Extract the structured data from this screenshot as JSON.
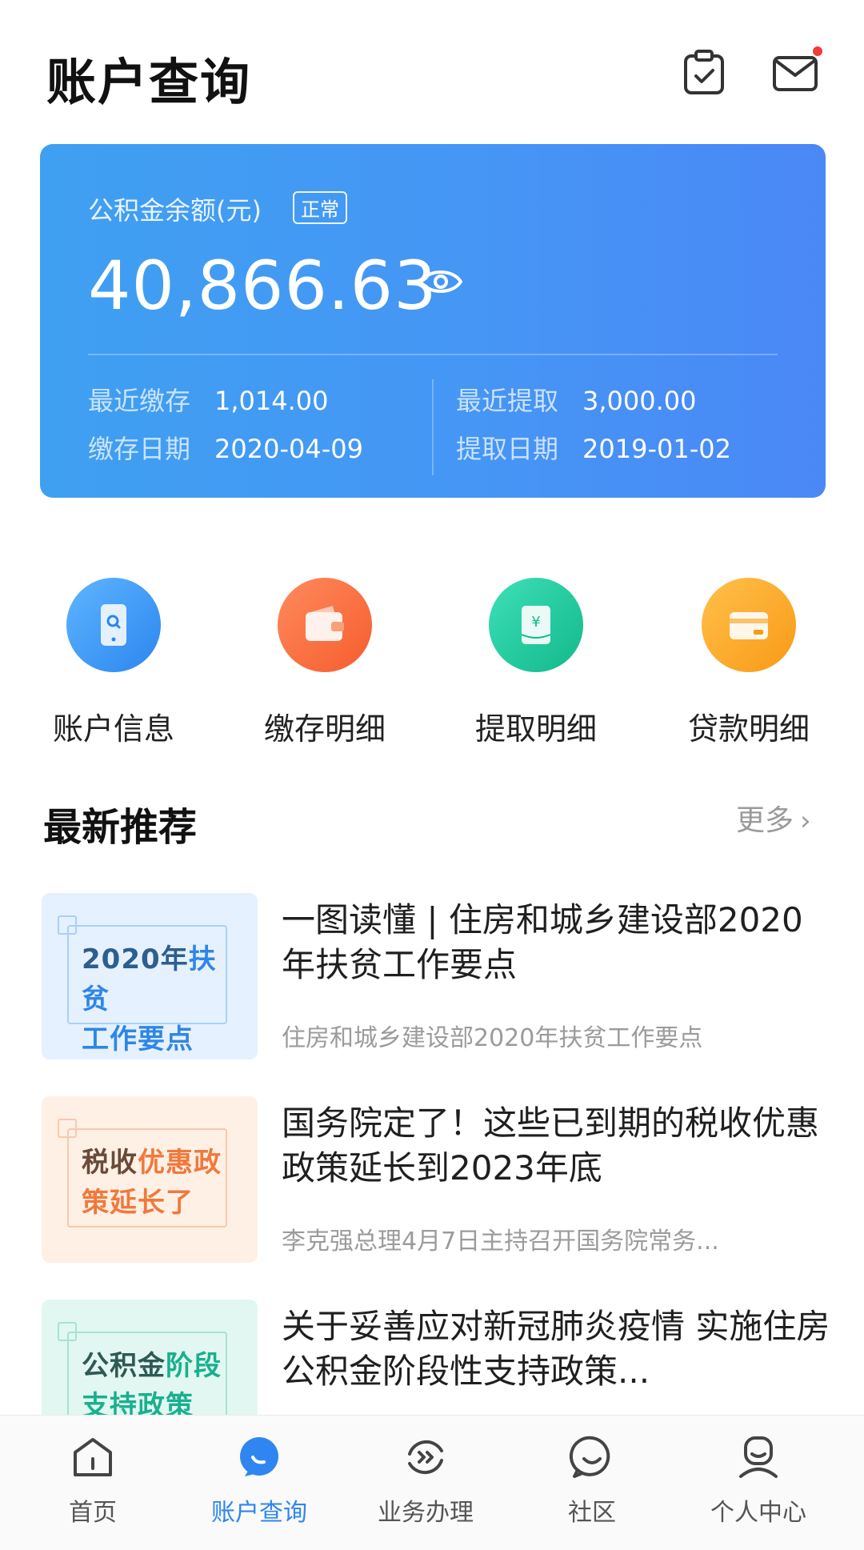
{
  "header": {
    "title": "账户查询",
    "clipboard_icon": "clipboard-check-icon",
    "mail_icon": "mail-icon",
    "mail_has_unread": true
  },
  "balance_card": {
    "label": "公积金余额(元)",
    "status": "正常",
    "amount": "40,866.63",
    "eye_icon": "eye-icon",
    "recent_deposit_label": "最近缴存",
    "recent_deposit_value": "1,014.00",
    "deposit_date_label": "缴存日期",
    "deposit_date_value": "2020-04-09",
    "recent_withdraw_label": "最近提取",
    "recent_withdraw_value": "3,000.00",
    "withdraw_date_label": "提取日期",
    "withdraw_date_value": "2019-01-02",
    "colors": {
      "start": "#3fa0f1",
      "end": "#4a88f6"
    }
  },
  "quick_actions": [
    {
      "label": "账户信息",
      "icon": "phone-search-icon",
      "color": "#2b86ef"
    },
    {
      "label": "缴存明细",
      "icon": "wallet-icon",
      "color": "#f55d2e"
    },
    {
      "label": "提取明细",
      "icon": "yuan-receipt-icon",
      "color": "#12b88a"
    },
    {
      "label": "贷款明细",
      "icon": "card-icon",
      "color": "#f99a16"
    }
  ],
  "recommend": {
    "title": "最新推荐",
    "more_label": "更多",
    "items": [
      {
        "thumb_line1_a": "2020年",
        "thumb_line1_b": "扶贫",
        "thumb_line2": "工作要点",
        "title": "一图读懂 | 住房和城乡建设部2020年扶贫工作要点",
        "subtitle": "住房和城乡建设部2020年扶贫工作要点"
      },
      {
        "thumb_line1_a": "税收",
        "thumb_line1_b": "优惠政",
        "thumb_line2": "策延长了",
        "title": "国务院定了！这些已到期的税收优惠政策延长到2023年底",
        "subtitle": "李克强总理4月7日主持召开国务院常务..."
      },
      {
        "thumb_line1_a": "公积金",
        "thumb_line1_b": "阶段",
        "thumb_line2": "支持政策",
        "title": "关于妥善应对新冠肺炎疫情 实施住房公积金阶段性支持政策...",
        "subtitle": ""
      }
    ]
  },
  "tabbar": {
    "active_color": "#2f86f0",
    "tabs": [
      {
        "label": "首页",
        "icon": "home-icon",
        "active": false
      },
      {
        "label": "账户查询",
        "icon": "chat-search-icon",
        "active": true
      },
      {
        "label": "业务办理",
        "icon": "service-icon",
        "active": false
      },
      {
        "label": "社区",
        "icon": "smile-chat-icon",
        "active": false
      },
      {
        "label": "个人中心",
        "icon": "user-icon",
        "active": false
      }
    ]
  }
}
